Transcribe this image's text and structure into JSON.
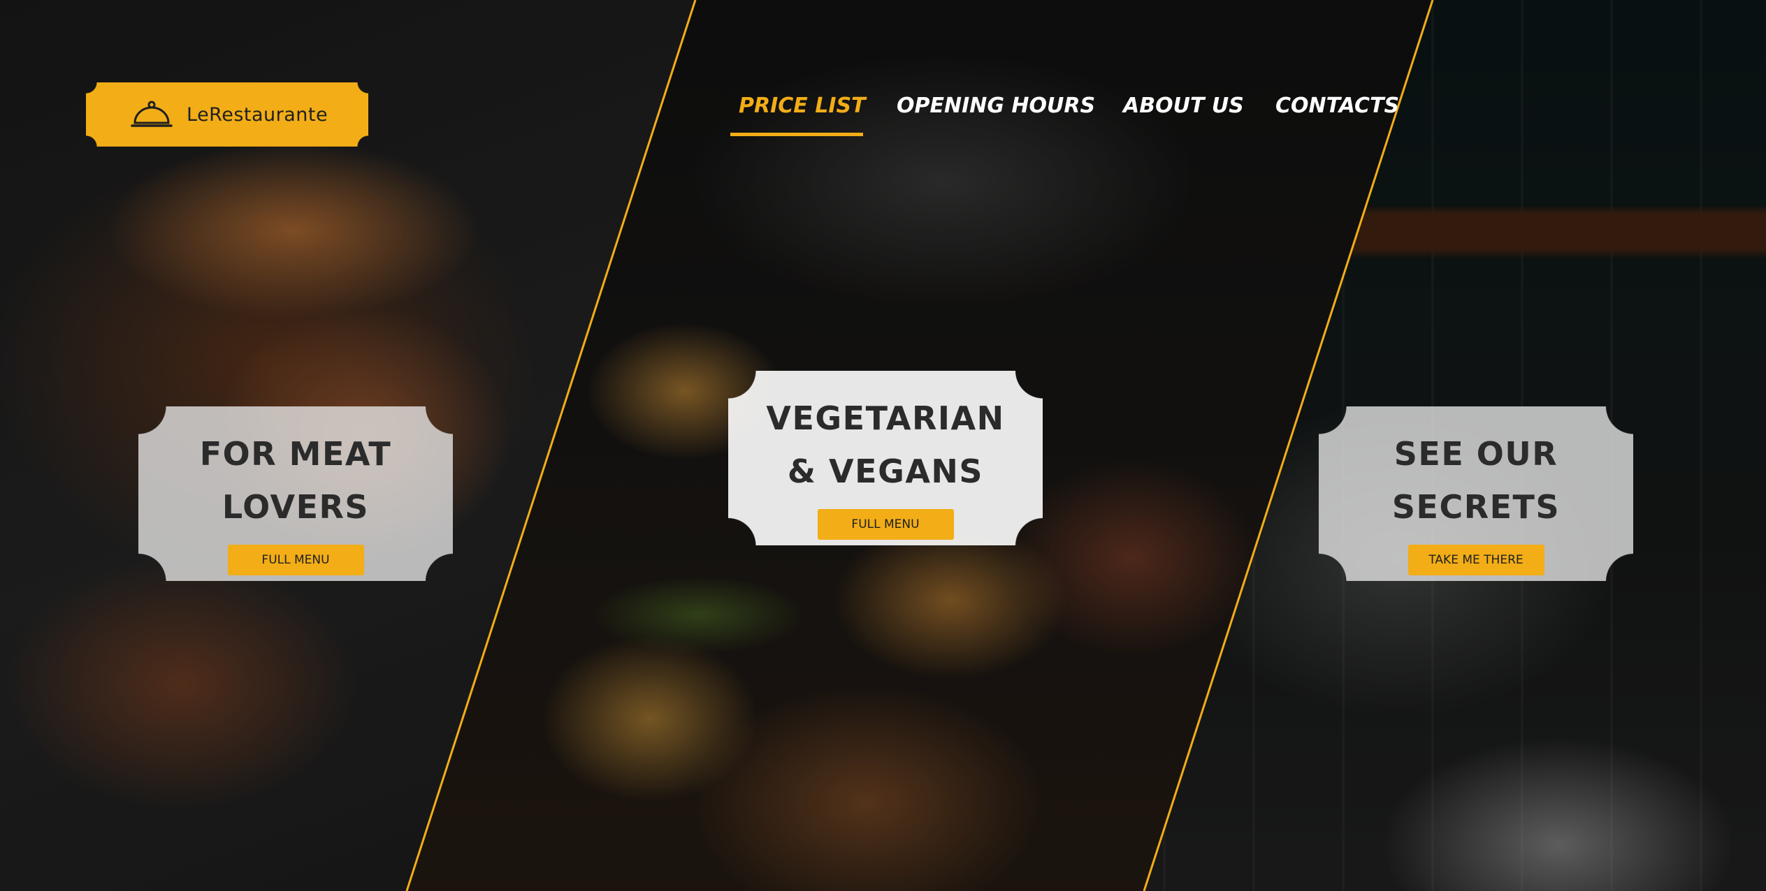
{
  "brand": {
    "name": "LeRestaurante",
    "icon": "cloche-icon",
    "accent_color": "#f2ad17"
  },
  "nav": {
    "items": [
      {
        "label": "PRICE LIST",
        "active": true
      },
      {
        "label": "OPENING HOURS",
        "active": false
      },
      {
        "label": "ABOUT US",
        "active": false
      },
      {
        "label": "CONTACTS",
        "active": false
      }
    ]
  },
  "cards": [
    {
      "title_lines": [
        "FOR MEAT",
        "LOVERS"
      ],
      "button": "FULL MENU"
    },
    {
      "title_lines": [
        "VEGETARIAN",
        "& VEGANS"
      ],
      "button": "FULL MENU"
    },
    {
      "title_lines": [
        "SEE OUR",
        "SECRETS"
      ],
      "button": "TAKE ME THERE"
    }
  ]
}
